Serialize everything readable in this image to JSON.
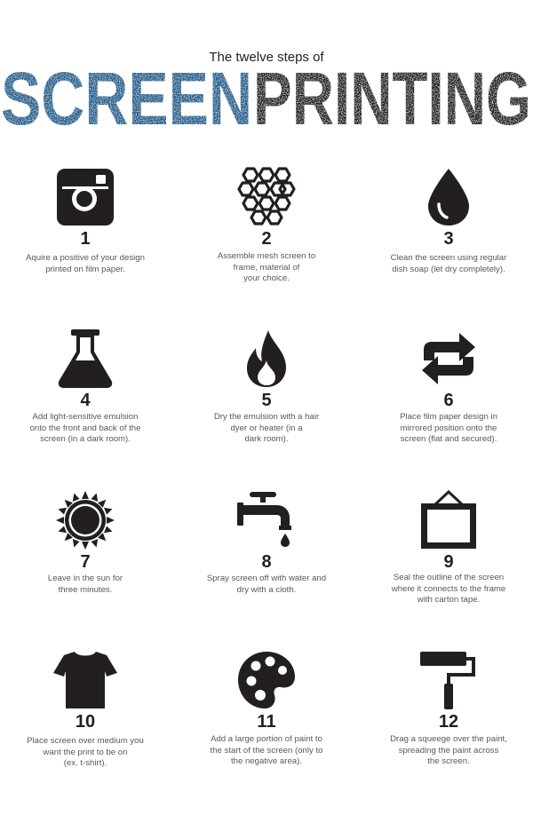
{
  "header": {
    "subtitle": "The twelve steps of",
    "title_part1": "SCREEN",
    "title_part2": "PRINTING",
    "color_part1": "#1a5f8f",
    "color_part2": "#231f20"
  },
  "steps": [
    {
      "number": "1",
      "icon": "instagram-camera-icon",
      "text": [
        "Aquire a positive of your design",
        "printed on film paper."
      ]
    },
    {
      "number": "2",
      "icon": "hexagon-mesh-icon",
      "text": [
        "Assemble mesh screen to",
        "frame, material of",
        "your choice."
      ]
    },
    {
      "number": "3",
      "icon": "water-drop-icon",
      "text": [
        "Clean the screen using regular",
        "dish soap (let dry completely)."
      ]
    },
    {
      "number": "4",
      "icon": "flask-icon",
      "text": [
        "Add light-sensitive emulsion",
        "onto the front and back of the",
        "screen (in a dark room)."
      ]
    },
    {
      "number": "5",
      "icon": "flame-icon",
      "text": [
        "Dry the emulsion with a hair",
        "dyer or heater (in a",
        "dark room)."
      ]
    },
    {
      "number": "6",
      "icon": "repeat-arrows-icon",
      "text": [
        "Place film paper design in",
        "mirrored position onto the",
        "screen (flat and secured)."
      ]
    },
    {
      "number": "7",
      "icon": "sun-icon",
      "text": [
        "Leave in the sun for",
        "three minutes."
      ]
    },
    {
      "number": "8",
      "icon": "faucet-icon",
      "text": [
        "Spray screen off with water and",
        "dry with a cloth."
      ]
    },
    {
      "number": "9",
      "icon": "hanging-frame-icon",
      "text": [
        "Seal the outline of the screen",
        "where it connects to the frame",
        "with carton tape."
      ]
    },
    {
      "number": "10",
      "icon": "t-shirt-icon",
      "text": [
        "Place screen over medium you",
        "want the print to be on",
        "(ex. t-shirt)."
      ]
    },
    {
      "number": "11",
      "icon": "paint-palette-icon",
      "text": [
        "Add a large portion of paint to",
        "the start of the screen (only to",
        "the negative area)."
      ]
    },
    {
      "number": "12",
      "icon": "paint-roller-icon",
      "text": [
        "Drag a squeege over the paint,",
        "spreading the paint across",
        "the screen."
      ]
    }
  ]
}
